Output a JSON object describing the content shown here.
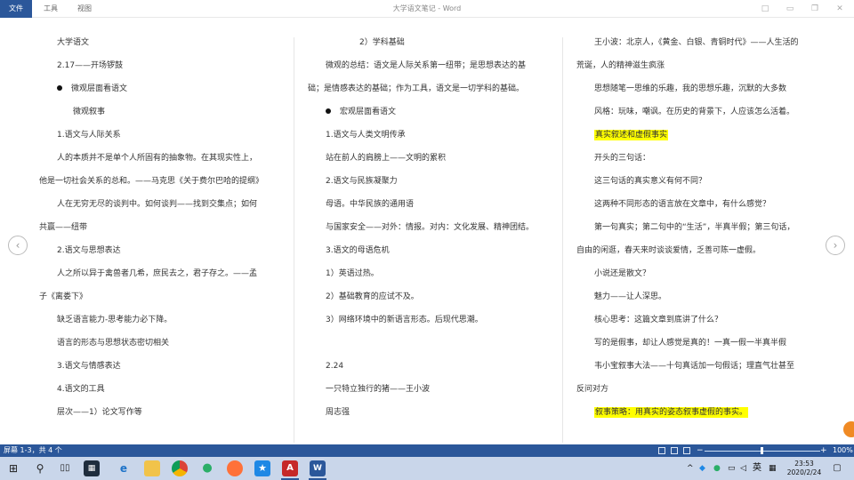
{
  "titlebar": {
    "tabs": [
      "文件",
      "工具",
      "视图"
    ],
    "title": "大学语文笔记 - Word"
  },
  "columns": [
    [
      {
        "text": "大学语文",
        "indent": 20
      },
      {
        "text": "2.17——开场锣鼓",
        "indent": 20
      },
      {
        "text": "微观层面看语文",
        "indent": 20,
        "bullet": true
      },
      {
        "text": "微观叙事",
        "indent": 38
      },
      {
        "text": "1.语文与人际关系",
        "indent": 20
      },
      {
        "text": "人的本质并不是单个人所固有的抽象物。在其现实性上，",
        "indent": 20
      },
      {
        "text": "他是一切社会关系的总和。——马克思《关于费尔巴哈的提纲》",
        "indent": 0
      },
      {
        "text": "人在无穷无尽的谈判中。如何谈判——找到交集点；如何",
        "indent": 20
      },
      {
        "text": "共赢——纽带",
        "indent": 0
      },
      {
        "text": "2.语文与思想表达",
        "indent": 20
      },
      {
        "text": "人之所以异于禽兽者几希，庶民去之，君子存之。——孟",
        "indent": 20
      },
      {
        "text": "子《离娄下》",
        "indent": 0
      },
      {
        "text": "缺乏语言能力-思考能力必下降。",
        "indent": 20
      },
      {
        "text": "语言的形态与思想状态密切相关",
        "indent": 20
      },
      {
        "text": "3.语文与情感表达",
        "indent": 20
      },
      {
        "text": "4.语文的工具",
        "indent": 20
      },
      {
        "text": "层次——1）论文写作等",
        "indent": 20
      }
    ],
    [
      {
        "text": "2）学科基础",
        "indent": 58
      },
      {
        "text": "微观的总结：语文是人际关系第一纽带；是思想表达的基",
        "indent": 20
      },
      {
        "text": "础；是情感表达的基础；作为工具，语文是一切学科的基础。",
        "indent": 0
      },
      {
        "text": "宏观层面看语文",
        "indent": 20,
        "bullet": true
      },
      {
        "text": "1.语文与人类文明传承",
        "indent": 20
      },
      {
        "text": "站在前人的肩膀上——文明的累积",
        "indent": 20
      },
      {
        "text": "2.语文与民族凝聚力",
        "indent": 20
      },
      {
        "text": "母语。中华民族的通用语",
        "indent": 20
      },
      {
        "text": "与国家安全——对外：情报。对内：文化发展、精神团结。",
        "indent": 20
      },
      {
        "text": "3.语文的母语危机",
        "indent": 20
      },
      {
        "text": "1）英语过热。",
        "indent": 20
      },
      {
        "text": "2）基础教育的应试不及。",
        "indent": 20
      },
      {
        "text": "3）网络环境中的新语言形态。后现代思潮。",
        "indent": 20
      },
      {
        "text": "",
        "indent": 20
      },
      {
        "text": "2.24",
        "indent": 20
      },
      {
        "text": "一只特立独行的猪——王小波",
        "indent": 20
      },
      {
        "text": "周志强",
        "indent": 20
      }
    ],
    [
      {
        "text": "王小波：北京人，《黄金、白银、青铜时代》——人生活的",
        "indent": 20
      },
      {
        "text": "荒诞，人的精神滋生疯涨",
        "indent": 0
      },
      {
        "text": "思想随笔一思维的乐趣，我的思想乐趣，沉默的大多数",
        "indent": 20
      },
      {
        "text": "风格：玩味，嘲讽。在历史的背景下，人应该怎么活着。",
        "indent": 20
      },
      {
        "text": "真实叙述和虚假事实",
        "indent": 20,
        "highlight": true
      },
      {
        "text": "开头的三句话：",
        "indent": 20
      },
      {
        "text": "这三句话的真实意义有何不同？",
        "indent": 20
      },
      {
        "text": "这两种不同形态的语言放在文章中，有什么感觉？",
        "indent": 20
      },
      {
        "text": "第一句真实；第二句中的“生活”，半真半假；第三句话，",
        "indent": 20
      },
      {
        "text": "自由的闲逛，春天来时谈谈爱情，乏善可陈一虚假。",
        "indent": 0
      },
      {
        "text": "小说还是散文？",
        "indent": 20
      },
      {
        "text": "魅力——让人深思。",
        "indent": 20
      },
      {
        "text": "核心思考：这篇文章到底讲了什么？",
        "indent": 20
      },
      {
        "text": "写的是假事，却让人感觉是真的！一真一假一半真半假",
        "indent": 20
      },
      {
        "text": "韦小宝叙事大法——十句真话加一句假话；理直气壮甚至",
        "indent": 20
      },
      {
        "text": "反问对方",
        "indent": 0
      },
      {
        "text": "叙事策略：用真实的姿态叙事虚假的事实。",
        "indent": 20,
        "highlight": true
      }
    ]
  ],
  "statusbar": {
    "pages": "屏幕 1-3，共 4 个",
    "zoom_minus": "−",
    "zoom_plus": "+",
    "zoom": "100%"
  },
  "taskbar": {
    "apps": [
      "windows-start",
      "search",
      "task-view",
      "store",
      "edge",
      "file-explorer",
      "chrome",
      "wechat",
      "firefox",
      "star-app",
      "pdf",
      "word"
    ],
    "tray_lang": "英",
    "time": "23:53",
    "date": "2020/2/24"
  },
  "colors": {
    "accent": "#2b579a",
    "highlight": "#ffff00",
    "taskbar": "#c9d6ea"
  }
}
